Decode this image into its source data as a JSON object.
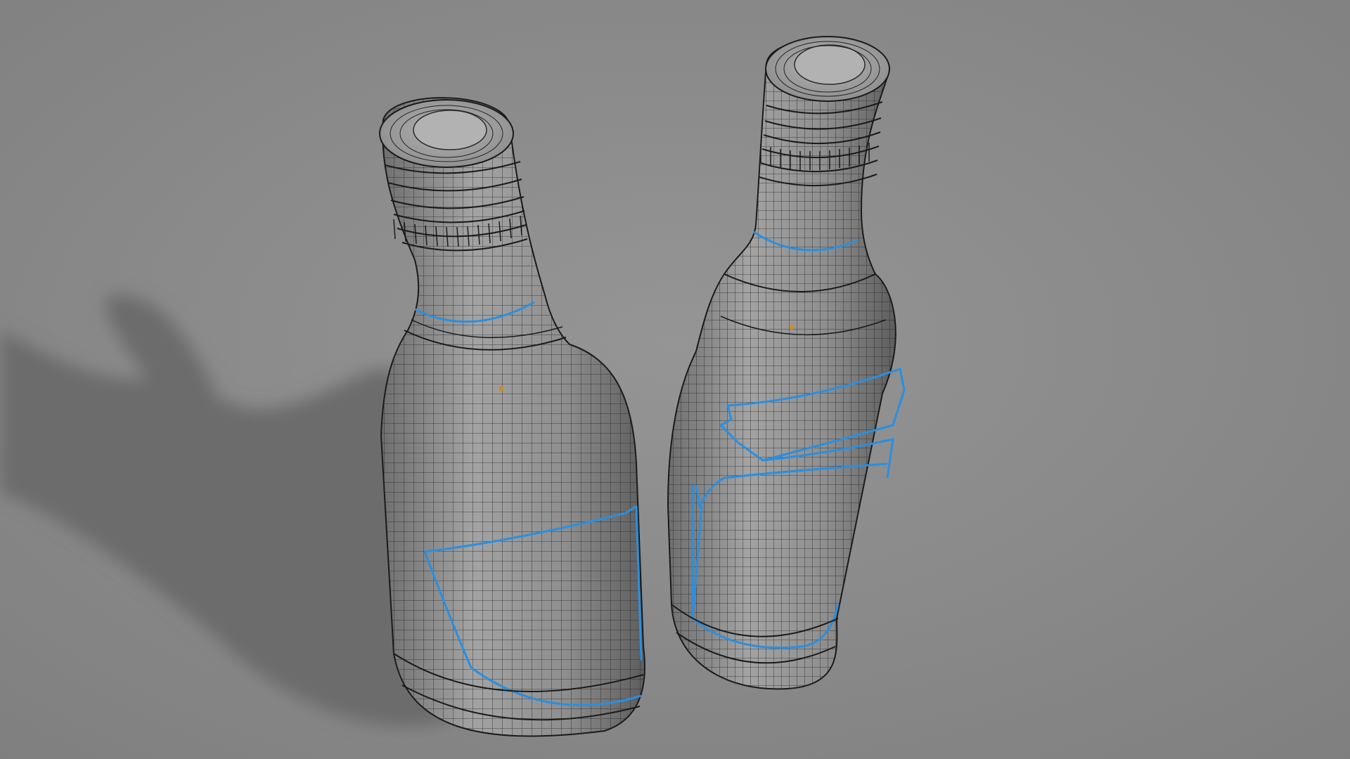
{
  "viewport": {
    "background_color": "#8a8a8a",
    "shadow_color": "#6e6e6e",
    "mesh_fill_color": "#8c8c8c",
    "mesh_highlight_color": "#a5a5a5",
    "wire_color": "#1f1f1f",
    "seam_color": "#2a8fe0",
    "origin_color": "#d08a2a"
  },
  "scene": {
    "objects": [
      {
        "name": "bottle-left",
        "type": "mesh",
        "selected": false
      },
      {
        "name": "bottle-right",
        "type": "mesh",
        "selected": false
      }
    ]
  }
}
